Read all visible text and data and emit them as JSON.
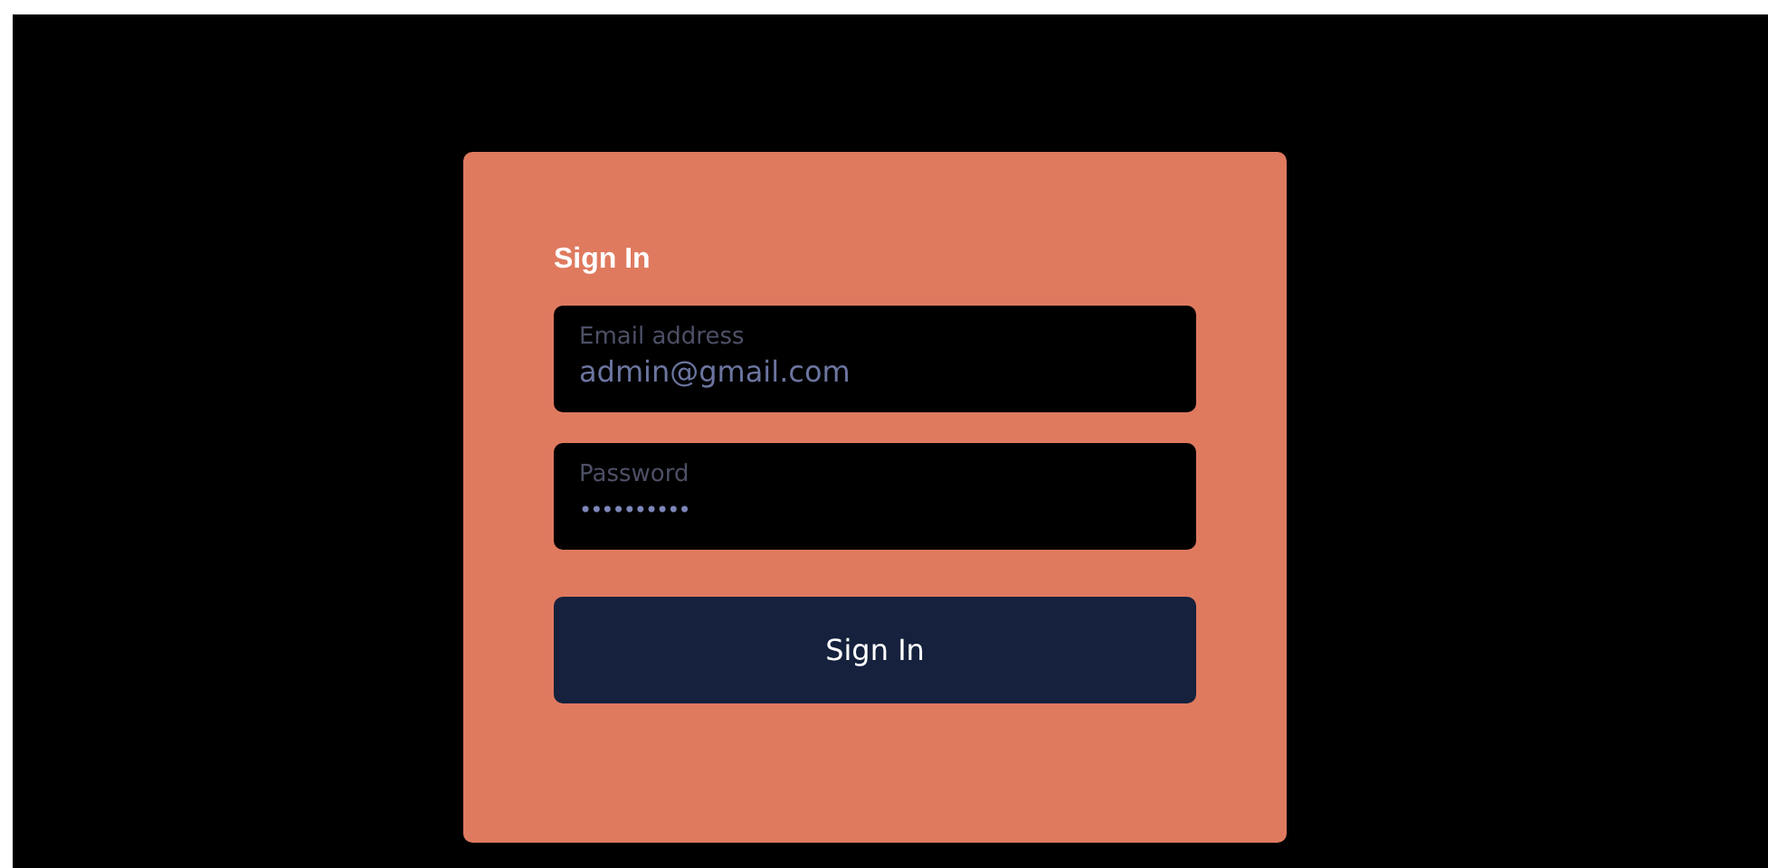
{
  "form": {
    "title": "Sign In",
    "fields": [
      {
        "kind": "email",
        "label": "Email address",
        "value": "admin@gmail.com"
      },
      {
        "kind": "password",
        "label": "Password",
        "value": "••••••••••"
      }
    ],
    "submit": "Sign In"
  }
}
